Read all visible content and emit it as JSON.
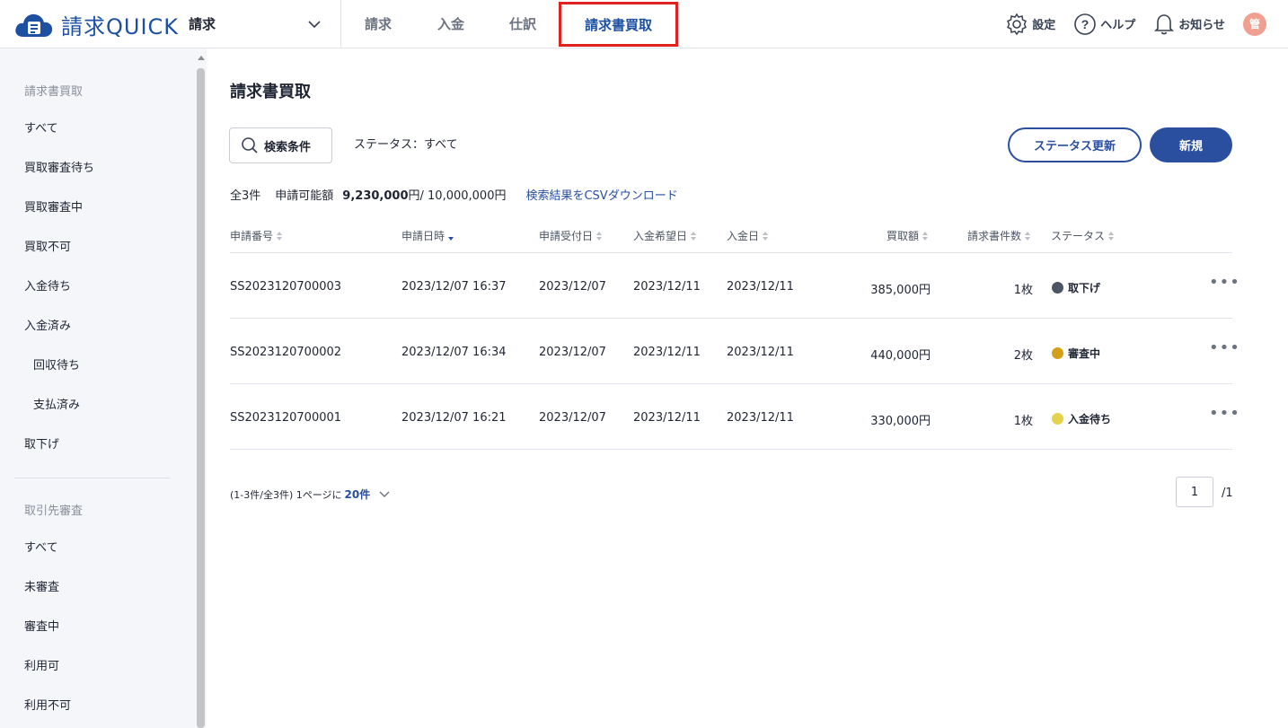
{
  "brand": {
    "name": "請求QUICK"
  },
  "header": {
    "app_selector": "請求",
    "nav": [
      "請求",
      "入金",
      "仕訳",
      "請求書買取"
    ],
    "active_nav": "請求書買取",
    "settings": "設定",
    "help": "ヘルプ",
    "notifications": "お知らせ",
    "avatar": "管"
  },
  "sidebar": {
    "section1_title": "請求書買取",
    "section1_items": [
      "すべて",
      "買取審査待ち",
      "買取審査中",
      "買取不可",
      "入金待ち",
      "入金済み",
      "回収待ち",
      "支払済み",
      "取下げ"
    ],
    "section2_title": "取引先審査",
    "section2_items": [
      "すべて",
      "未審査",
      "審査中",
      "利用可",
      "利用不可"
    ]
  },
  "main": {
    "title": "請求書買取",
    "search_button": "検索条件",
    "status_filter": "ステータス：すべて",
    "refresh_button": "ステータス更新",
    "new_button": "新規",
    "summary": {
      "count": "全3件",
      "available_label": "申請可能額",
      "available_value": "9,230,000",
      "available_unit": "円",
      "available_total": " / 10,000,000円",
      "csv_link": "検索結果をCSVダウンロード"
    },
    "columns": [
      "申請番号",
      "申請日時",
      "申請受付日",
      "入金希望日",
      "入金日",
      "買取額",
      "請求書件数",
      "ステータス"
    ],
    "rows": [
      {
        "id": "SS2023120700003",
        "datetime": "2023/12/07 16:37",
        "received": "2023/12/07",
        "desired": "2023/12/11",
        "paid": "2023/12/11",
        "amount": "385,000円",
        "count": "1枚",
        "status": "取下げ",
        "status_color": "#4b5563"
      },
      {
        "id": "SS2023120700002",
        "datetime": "2023/12/07 16:34",
        "received": "2023/12/07",
        "desired": "2023/12/11",
        "paid": "2023/12/11",
        "amount": "440,000円",
        "count": "2枚",
        "status": "審査中",
        "status_color": "#d4a017"
      },
      {
        "id": "SS2023120700001",
        "datetime": "2023/12/07 16:21",
        "received": "2023/12/07",
        "desired": "2023/12/11",
        "paid": "2023/12/11",
        "amount": "330,000円",
        "count": "1枚",
        "status": "入金待ち",
        "status_color": "#e3d24a"
      }
    ],
    "more_icon": "•••",
    "pager": {
      "info": "(1-3件/全3件)  1ページに",
      "per_page": "20件",
      "current_page": "1",
      "total_pages": "/1"
    }
  }
}
